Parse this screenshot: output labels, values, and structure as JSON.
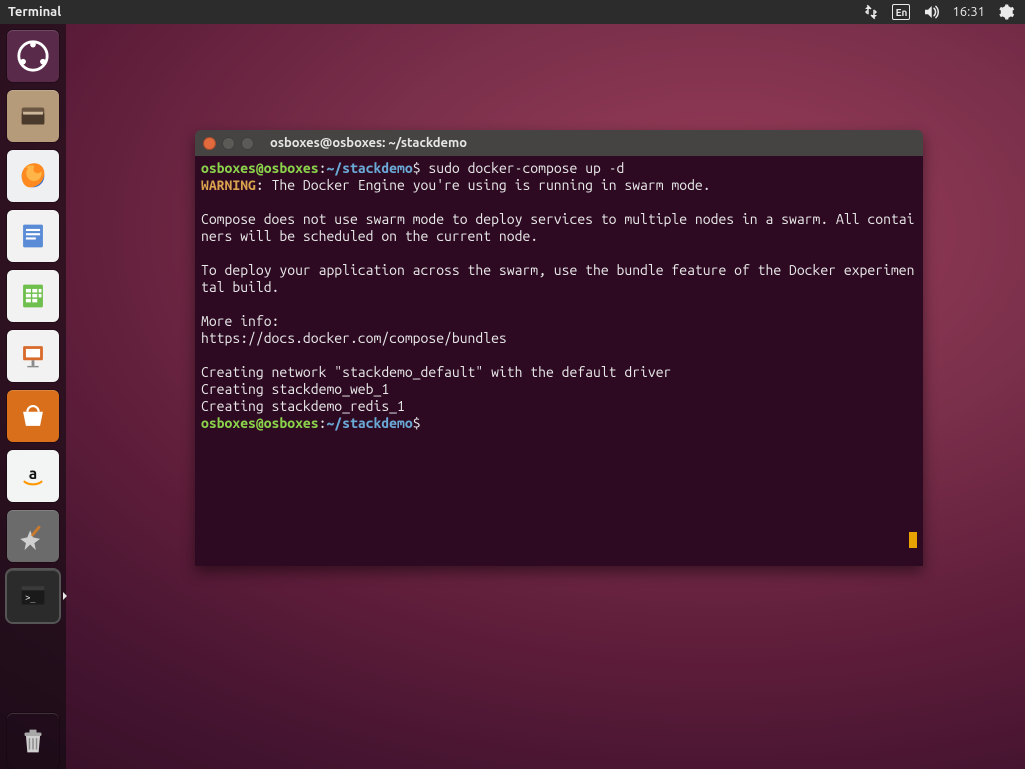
{
  "top_panel": {
    "app_title": "Terminal",
    "keyboard_indicator": "En",
    "clock": "16:31"
  },
  "launcher": {
    "items": [
      {
        "id": "dash",
        "name": "Ubuntu Dash"
      },
      {
        "id": "files",
        "name": "Files"
      },
      {
        "id": "firefox",
        "name": "Firefox"
      },
      {
        "id": "writer",
        "name": "LibreOffice Writer"
      },
      {
        "id": "calc",
        "name": "LibreOffice Calc"
      },
      {
        "id": "impress",
        "name": "LibreOffice Impress"
      },
      {
        "id": "software",
        "name": "Ubuntu Software"
      },
      {
        "id": "amazon",
        "name": "Amazon"
      },
      {
        "id": "settings",
        "name": "System Settings"
      },
      {
        "id": "terminal",
        "name": "Terminal",
        "active": true
      },
      {
        "id": "trash",
        "name": "Trash"
      }
    ]
  },
  "terminal": {
    "title": "osboxes@osboxes: ~/stackdemo",
    "prompt": {
      "user_host": "osboxes@osboxes",
      "colon": ":",
      "path": "~/stackdemo",
      "dollar": "$ "
    },
    "command": "sudo docker-compose up -d",
    "warning_label": "WARNING",
    "warning_text": ": The Docker Engine you're using is running in swarm mode.",
    "body_lines_1": "Compose does not use swarm mode to deploy services to multiple nodes in a swarm. All containers will be scheduled on the current node.",
    "body_lines_2": "To deploy your application across the swarm, use the bundle feature of the Docker experimental build.",
    "more_info_label": "More info:",
    "more_info_url": "https://docs.docker.com/compose/bundles",
    "creating_lines": [
      "Creating network \"stackdemo_default\" with the default driver",
      "Creating stackdemo_web_1",
      "Creating stackdemo_redis_1"
    ]
  }
}
